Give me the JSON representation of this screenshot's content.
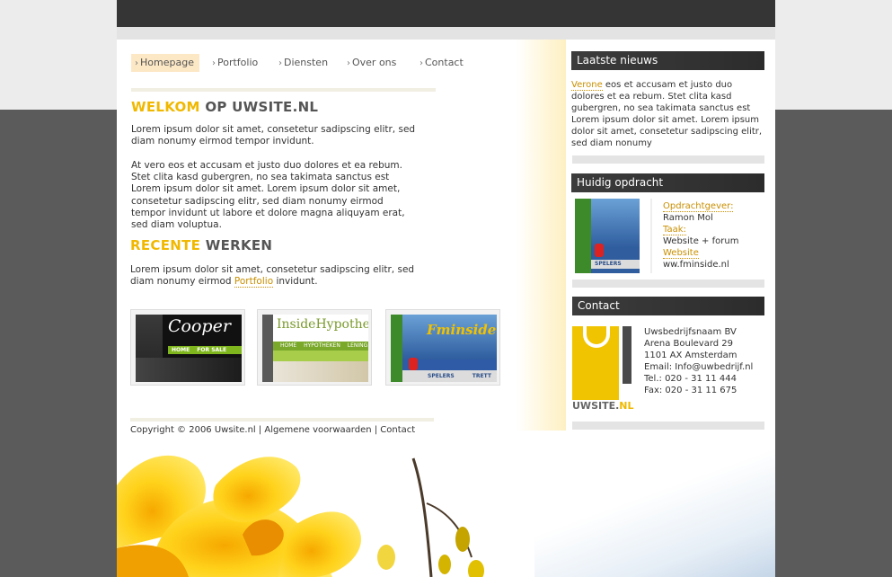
{
  "nav": {
    "items": [
      "Homepage",
      "Portfolio",
      "Diensten",
      "Over ons",
      "Contact"
    ]
  },
  "welcome": {
    "title_highlight": "WELKOM",
    "title_rest": "OP UWSITE.NL",
    "para1": "Lorem ipsum dolor sit amet, consetetur sadipscing elitr, sed diam nonumy eirmod tempor invidunt.",
    "para2": "At vero eos et accusam et justo duo dolores et ea rebum. Stet clita kasd gubergren, no sea takimata sanctus est Lorem ipsum dolor sit amet. Lorem ipsum dolor sit amet, consetetur sadipscing elitr, sed diam nonumy eirmod tempor invidunt ut labore et dolore magna aliquyam erat, sed diam voluptua."
  },
  "recent": {
    "title_highlight": "RECENTE",
    "title_rest": "WERKEN",
    "text_before": "Lorem ipsum dolor sit amet, consetetur sadipscing elitr, sed diam nonumy eirmod",
    "link": "Portfolio",
    "text_after": "invidunt.",
    "thumbs": [
      {
        "brand": "Cooper",
        "nav1": "HOME",
        "nav2": "FOR SALE"
      },
      {
        "brand": "InsideHypothe",
        "nav1": "HOME",
        "nav2": "HYPOTHEKEN",
        "nav3": "LENING"
      },
      {
        "brand": "Fminside",
        "nav1": "SPELERS",
        "nav2": "TRETT"
      }
    ]
  },
  "footer": {
    "text": "Copyright © 2006 Uwsite.nl | Algemene voorwaarden | Contact"
  },
  "news": {
    "heading": "Laatste nieuws",
    "author": "Verone",
    "text": "eos et accusam et justo duo dolores et ea rebum. Stet clita kasd gubergren, no sea takimata sanctus est Lorem ipsum dolor sit amet. Lorem ipsum dolor sit amet, consetetur sadipscing elitr, sed diam nonumy"
  },
  "assignment": {
    "heading": "Huidig opdracht",
    "client_label": "Opdrachtgever:",
    "client": "Ramon Mol",
    "task_label": "Taak:",
    "task": "Website + forum",
    "website_label": "Website",
    "website": "ww.fminside.nl",
    "thumb_text": "SPELERS"
  },
  "contact": {
    "heading": "Contact",
    "logo_main": "UWSITE.",
    "logo_accent": "NL",
    "company": "Uwsbedrijfsnaam BV",
    "address": "Arena Boulevard 29",
    "city": "1101 AX Amsterdam",
    "email": "Email: Info@uwbedrijf.nl",
    "tel": "Tel.: 020 - 31 11 444",
    "fax": "Fax: 020 - 31 11 675"
  },
  "colors": {
    "accent": "#f0b800",
    "dark": "#353535",
    "background": "#5b5b5b"
  }
}
